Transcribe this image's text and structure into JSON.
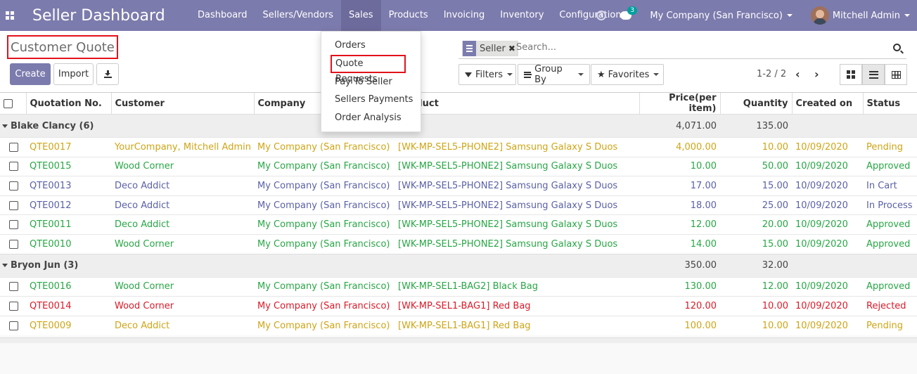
{
  "navbar": {
    "brand": "Seller Dashboard",
    "menu": [
      "Dashboard",
      "Sellers/Vendors",
      "Sales",
      "Products",
      "Invoicing",
      "Inventory",
      "Configuration"
    ],
    "active": "Sales",
    "chat_count": "3",
    "company": "My Company (San Francisco)",
    "user": "Mitchell Admin"
  },
  "breadcrumb": "Customer Quote",
  "buttons": {
    "create": "Create",
    "import": "Import"
  },
  "search": {
    "facet": "Seller",
    "placeholder": "Search..."
  },
  "filters": {
    "filters": "Filters",
    "group_by": "Group By",
    "favorites": "Favorites"
  },
  "pager": "1-2 / 2",
  "dropdown": [
    "Orders",
    "Quote Requests",
    "Pay To Seller",
    "Sellers Payments",
    "Order Analysis"
  ],
  "columns": [
    "Quotation No.",
    "Customer",
    "Company",
    "Product",
    "Price(per item)",
    "Quantity",
    "Created on",
    "Status"
  ],
  "groups": [
    {
      "label": "Blake Clancy (6)",
      "price": "4,071.00",
      "qty": "135.00",
      "rows": [
        {
          "no": "QTE0017",
          "customer": "YourCompany, Mitchell Admin",
          "company": "My Company (San Francisco)",
          "product": "[WK-MP-SEL5-PHONE2] Samsung Galaxy S Duos",
          "price": "4,000.00",
          "qty": "10.00",
          "date": "10/09/2020",
          "status": "Pending",
          "color": "pending"
        },
        {
          "no": "QTE0015",
          "customer": "Wood Corner",
          "company": "My Company (San Francisco)",
          "product": "[WK-MP-SEL5-PHONE2] Samsung Galaxy S Duos",
          "price": "10.00",
          "qty": "50.00",
          "date": "10/09/2020",
          "status": "Approved",
          "color": "approved"
        },
        {
          "no": "QTE0013",
          "customer": "Deco Addict",
          "company": "My Company (San Francisco)",
          "product": "[WK-MP-SEL5-PHONE2] Samsung Galaxy S Duos",
          "price": "17.00",
          "qty": "15.00",
          "date": "10/09/2020",
          "status": "In Cart",
          "color": "blue"
        },
        {
          "no": "QTE0012",
          "customer": "Deco Addict",
          "company": "My Company (San Francisco)",
          "product": "[WK-MP-SEL5-PHONE2] Samsung Galaxy S Duos",
          "price": "18.00",
          "qty": "25.00",
          "date": "10/09/2020",
          "status": "In Process",
          "color": "blue"
        },
        {
          "no": "QTE0011",
          "customer": "Deco Addict",
          "company": "My Company (San Francisco)",
          "product": "[WK-MP-SEL5-PHONE2] Samsung Galaxy S Duos",
          "price": "12.00",
          "qty": "20.00",
          "date": "10/09/2020",
          "status": "Approved",
          "color": "approved"
        },
        {
          "no": "QTE0010",
          "customer": "Wood Corner",
          "company": "My Company (San Francisco)",
          "product": "[WK-MP-SEL5-PHONE2] Samsung Galaxy S Duos",
          "price": "14.00",
          "qty": "15.00",
          "date": "10/09/2020",
          "status": "Approved",
          "color": "approved"
        }
      ]
    },
    {
      "label": "Bryon Jun (3)",
      "price": "350.00",
      "qty": "32.00",
      "rows": [
        {
          "no": "QTE0016",
          "customer": "Wood Corner",
          "company": "My Company (San Francisco)",
          "product": "[WK-MP-SEL1-BAG2] Black Bag",
          "price": "130.00",
          "qty": "12.00",
          "date": "10/09/2020",
          "status": "Approved",
          "color": "approved"
        },
        {
          "no": "QTE0014",
          "customer": "Wood Corner",
          "company": "My Company (San Francisco)",
          "product": "[WK-MP-SEL1-BAG1] Red Bag",
          "price": "120.00",
          "qty": "10.00",
          "date": "10/09/2020",
          "status": "Rejected",
          "color": "rejected"
        },
        {
          "no": "QTE0009",
          "customer": "Deco Addict",
          "company": "My Company (San Francisco)",
          "product": "[WK-MP-SEL1-BAG1] Red Bag",
          "price": "100.00",
          "qty": "10.00",
          "date": "10/09/2020",
          "status": "Pending",
          "color": "pending"
        }
      ]
    }
  ],
  "colors": {
    "navbar": "#7c7bad",
    "pending": "#cfa517",
    "approved": "#28a745",
    "in_progress": "#5b61a6",
    "rejected": "#dc1a28",
    "highlight_box": "#e3121b"
  }
}
